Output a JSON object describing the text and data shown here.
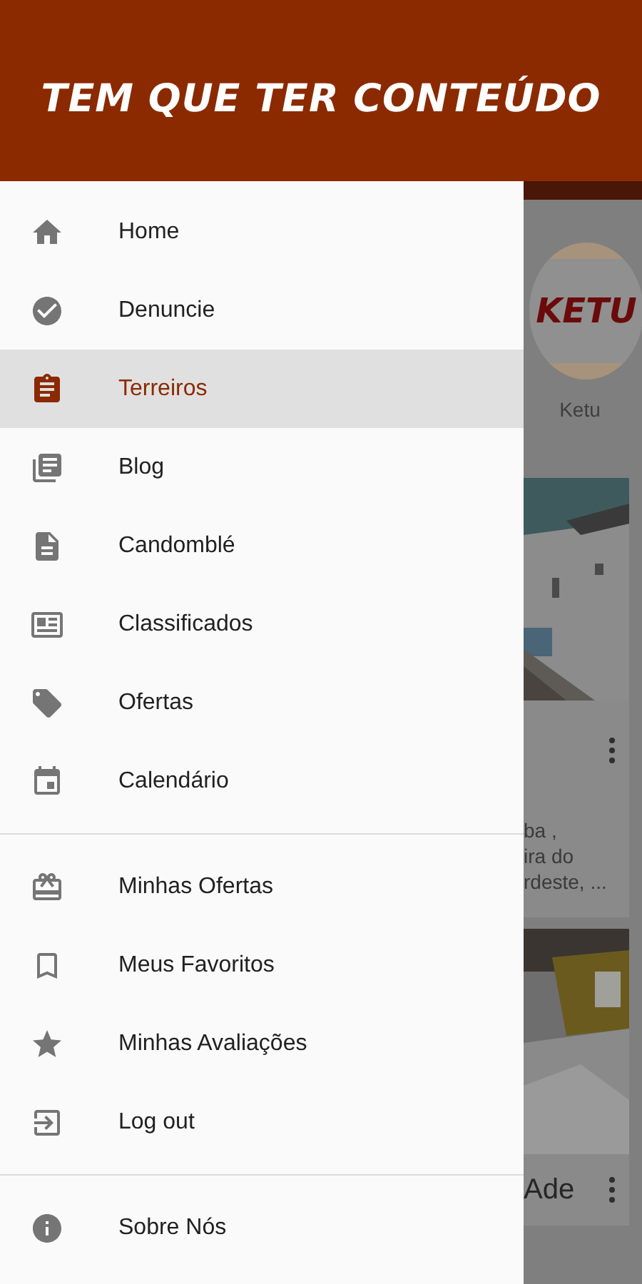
{
  "header": {
    "title": "TEM QUE TER CONTEÚDO"
  },
  "drawer": {
    "sections": [
      {
        "items": [
          {
            "label": "Home",
            "kind": "home",
            "selected": false
          },
          {
            "label": "Denuncie",
            "kind": "check",
            "selected": false
          },
          {
            "label": "Terreiros",
            "kind": "clipboard",
            "selected": true
          },
          {
            "label": "Blog",
            "kind": "library",
            "selected": false
          },
          {
            "label": "Candomblé",
            "kind": "document",
            "selected": false
          },
          {
            "label": "Classificados",
            "kind": "newspaper",
            "selected": false
          },
          {
            "label": "Ofertas",
            "kind": "tag",
            "selected": false
          },
          {
            "label": "Calendário",
            "kind": "calendar",
            "selected": false
          }
        ]
      },
      {
        "items": [
          {
            "label": "Minhas Ofertas",
            "kind": "gift",
            "selected": false
          },
          {
            "label": "Meus Favoritos",
            "kind": "bookmark",
            "selected": false
          },
          {
            "label": "Minhas Avaliações",
            "kind": "star",
            "selected": false
          },
          {
            "label": "Log out",
            "kind": "logout",
            "selected": false
          }
        ]
      },
      {
        "items": [
          {
            "label": "Sobre Nós",
            "kind": "info",
            "selected": false
          }
        ]
      }
    ]
  },
  "background": {
    "logo_text": "KETU",
    "category_label": "Ketu",
    "card_text": [
      "ba ,",
      "ira do",
      "rdeste, ..."
    ],
    "card_title": "Ade"
  }
}
